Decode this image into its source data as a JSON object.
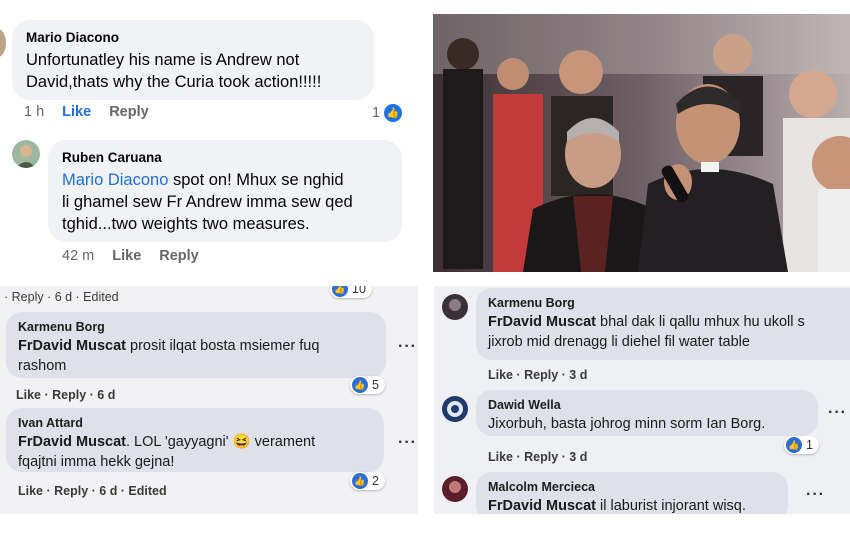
{
  "top_left": {
    "comment1": {
      "author": "Mario Diacono",
      "text_line1": "Unfortunatley his name is Andrew not",
      "text_line2": "David,thats why the Curia took action!!!!!",
      "time": "1 h",
      "like": "Like",
      "reply": "Reply",
      "reaction_count": "1"
    },
    "comment2": {
      "author": "Ruben Caruana",
      "mention": "Mario Diacono",
      "text_line1": " spot on! Mhux se nghid",
      "text_line2": "li ghamel sew Fr Andrew imma sew qed",
      "text_line3": "tghid...two weights two measures.",
      "time": "42 m",
      "like": "Like",
      "reply": "Reply"
    }
  },
  "bottom_left": {
    "top_meta": "· Reply · 6 d · Edited",
    "top_reaction_count": "10",
    "comment1": {
      "author": "Karmenu Borg",
      "mention": "FrDavid Muscat",
      "text_line1": " prosit ilqat bosta msiemer fuq",
      "text_line2": "rashom",
      "meta": "Like · Reply · 6 d",
      "reaction_count": "5"
    },
    "comment2": {
      "author": "Ivan Attard",
      "mention": "FrDavid Muscat",
      "text_line1": ". LOL 'gayyagni'",
      "text_line1b": " verament",
      "text_line2": "fqajtni imma hekk gejna!",
      "meta": "Like · Reply · 6 d · Edited",
      "reaction_count": "2"
    }
  },
  "bottom_right": {
    "comment1": {
      "author": "Karmenu Borg",
      "mention": "FrDavid Muscat",
      "text_line1": " bhal dak li qallu mhux hu ukoll s",
      "text_line2": "jixrob mid drenagg li diehel fil water table",
      "meta": "Like · Reply · 3 d"
    },
    "comment2": {
      "author": "Dawid Wella",
      "text_line1": "Jixorbuh, basta johrog minn sorm Ian Borg.",
      "meta": "Like · Reply · 3 d",
      "reaction_count": "1"
    },
    "comment3": {
      "author": "Malcolm Mercieca",
      "mention": "FrDavid Muscat",
      "text_line1": " il laburist injorant wisq."
    }
  },
  "colors": {
    "fb_link": "#216fdb",
    "fb_bubble": "#f0f2f5",
    "like_blue": "#1b74e4",
    "print_bubble": "#dfe1ea"
  },
  "icons": [
    "thumbs-up-icon",
    "laughing-emoji-icon",
    "more-options-icon",
    "avatar-icon"
  ]
}
